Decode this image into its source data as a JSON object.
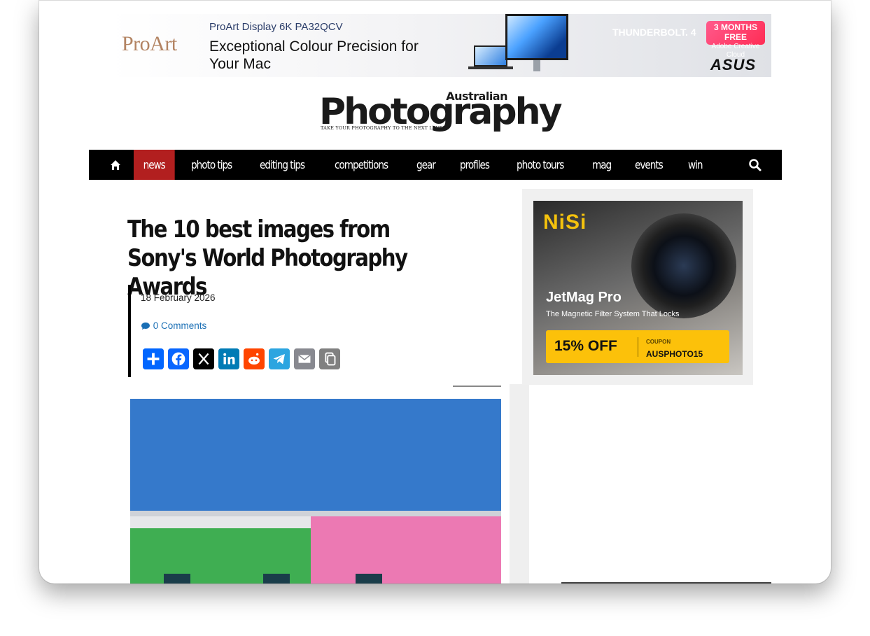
{
  "top_ad": {
    "brand": "ProArt",
    "model": "ProArt Display 6K PA32QCV",
    "headline": "Exceptional Colour Precision for Your Mac",
    "thunderbolt": "THUNDERBOLT. 4",
    "offer_months": "3 MONTHS FREE",
    "offer_app": "Adobe Creative Cloud",
    "maker": "ASUS"
  },
  "site": {
    "logo_small": "Australian",
    "logo_big": "Photography",
    "tagline": "TAKE YOUR PHOTOGRAPHY TO THE NEXT LEVEL"
  },
  "nav": {
    "home_icon": "home-icon",
    "items": [
      "news",
      "photo tips",
      "editing tips",
      "competitions",
      "gear",
      "profiles",
      "photo tours",
      "mag",
      "events",
      "win"
    ],
    "active": "news",
    "search_icon": "search-icon",
    "active_color": "#b21f1f"
  },
  "article": {
    "title": "The 10 best images from Sony's World Photography Awards",
    "date": "18 February 2026",
    "comments": "0 Comments",
    "share_buttons": [
      "Share",
      "Facebook",
      "X",
      "LinkedIn",
      "Reddit",
      "Telegram",
      "Email",
      "Copy Link"
    ]
  },
  "side_ad": {
    "brand": "NiSi",
    "product": "JetMag Pro",
    "tagline": "The Magnetic Filter System That Locks",
    "discount": "15% OFF",
    "coupon_label": "COUPON",
    "coupon_code": "AUSPHOTO15"
  }
}
